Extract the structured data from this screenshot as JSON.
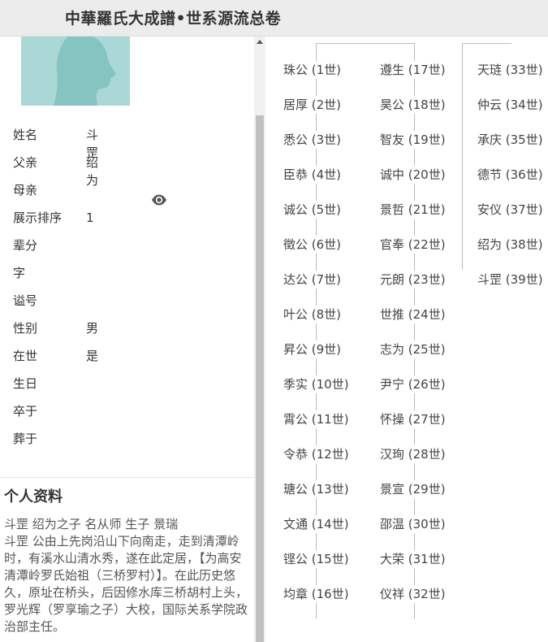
{
  "header": {
    "title": "中華羅氏大成譜•世系源流总卷"
  },
  "profile": {
    "avatar_icon": "person-silhouette-icon",
    "avatar_color": "#a9d8d6",
    "fields": [
      {
        "label": "姓名",
        "value": "斗罡"
      },
      {
        "label": "父亲",
        "value": "绍为"
      },
      {
        "label": "母亲",
        "value": ""
      },
      {
        "label": "展示排序",
        "value": "1"
      },
      {
        "label": "辈分",
        "value": ""
      },
      {
        "label": "字",
        "value": ""
      },
      {
        "label": "谥号",
        "value": ""
      },
      {
        "label": "性别",
        "value": "男"
      },
      {
        "label": "在世",
        "value": "是"
      },
      {
        "label": "生日",
        "value": ""
      },
      {
        "label": "卒于",
        "value": ""
      },
      {
        "label": "葬于",
        "value": ""
      }
    ]
  },
  "bio_section": {
    "title": "个人资料",
    "text": "斗罡  绍为之子 名从师  生子  景瑞\n斗罡 公由上先岗沿山下向南走，走到清潭岭时，有溪水山清水秀，遂在此定居，【为高安清潭岭罗氏始祖（三桥罗村）】。在此历史悠久，原址在桥头，后因修水库三桥胡村上头，罗光辉（罗享瑜之子）大校，国际关系学院政治部主任。"
  },
  "generations": {
    "col1": [
      "珠公 (1世)",
      "居厚 (2世)",
      "悉公 (3世)",
      "臣恭 (4世)",
      "诚公 (5世)",
      "徵公 (6世)",
      "达公 (7世)",
      "叶公 (8世)",
      "昇公 (9世)",
      "季实 (10世)",
      "霄公 (11世)",
      "令恭 (12世)",
      "瑭公 (13世)",
      "文通 (14世)",
      "铿公 (15世)",
      "均章 (16世)"
    ],
    "col2": [
      "遵生 (17世)",
      "昊公 (18世)",
      "智友 (19世)",
      "诚中 (20世)",
      "景哲 (21世)",
      "官奉 (22世)",
      "元朗 (23世)",
      "世推 (24世)",
      "志为 (25世)",
      "尹宁 (26世)",
      "怀操 (27世)",
      "汉珣 (28世)",
      "景宣 (29世)",
      "邵温 (30世)",
      "大荣 (31世)",
      "仪祥 (32世)"
    ],
    "col3": [
      "天琏 (33世)",
      "仲云 (34世)",
      "承庆 (35世)",
      "德节 (36世)",
      "安仪 (37世)",
      "绍为 (38世)",
      "斗罡 (39世)"
    ]
  }
}
